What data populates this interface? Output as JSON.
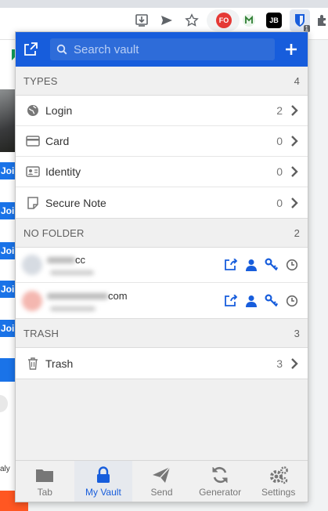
{
  "chrome": {
    "extensions": [
      {
        "name": "fo-extension",
        "label": "FO",
        "bg": "#e53935",
        "fg": "#ffffff"
      },
      {
        "name": "jb-extension",
        "label": "JB",
        "bg": "#000000",
        "fg": "#ffffff"
      }
    ],
    "bitwarden_badge": "1"
  },
  "page": {
    "join_label": "Joir",
    "small_text": "aly"
  },
  "popup": {
    "search": {
      "placeholder": "Search vault"
    },
    "types": {
      "header": "TYPES",
      "count": "4",
      "items": [
        {
          "label": "Login",
          "count": "2",
          "icon": "globe-icon"
        },
        {
          "label": "Card",
          "count": "0",
          "icon": "card-icon"
        },
        {
          "label": "Identity",
          "count": "0",
          "icon": "id-card-icon"
        },
        {
          "label": "Secure Note",
          "count": "0",
          "icon": "note-icon"
        }
      ]
    },
    "no_folder": {
      "header": "NO FOLDER",
      "count": "2",
      "items": [
        {
          "name_suffix": "cc"
        },
        {
          "name_suffix": "com"
        }
      ]
    },
    "trash": {
      "header": "TRASH",
      "count": "3",
      "items": [
        {
          "label": "Trash",
          "count": "3",
          "icon": "trash-icon"
        }
      ]
    },
    "tabs": [
      {
        "label": "Tab",
        "icon": "folder-icon",
        "active": false
      },
      {
        "label": "My Vault",
        "icon": "lock-icon",
        "active": true
      },
      {
        "label": "Send",
        "icon": "send-icon",
        "active": false
      },
      {
        "label": "Generator",
        "icon": "refresh-icon",
        "active": false
      },
      {
        "label": "Settings",
        "icon": "cogs-icon",
        "active": false
      }
    ],
    "colors": {
      "brand": "#175ddc",
      "action_icon": "#175ddc"
    }
  }
}
